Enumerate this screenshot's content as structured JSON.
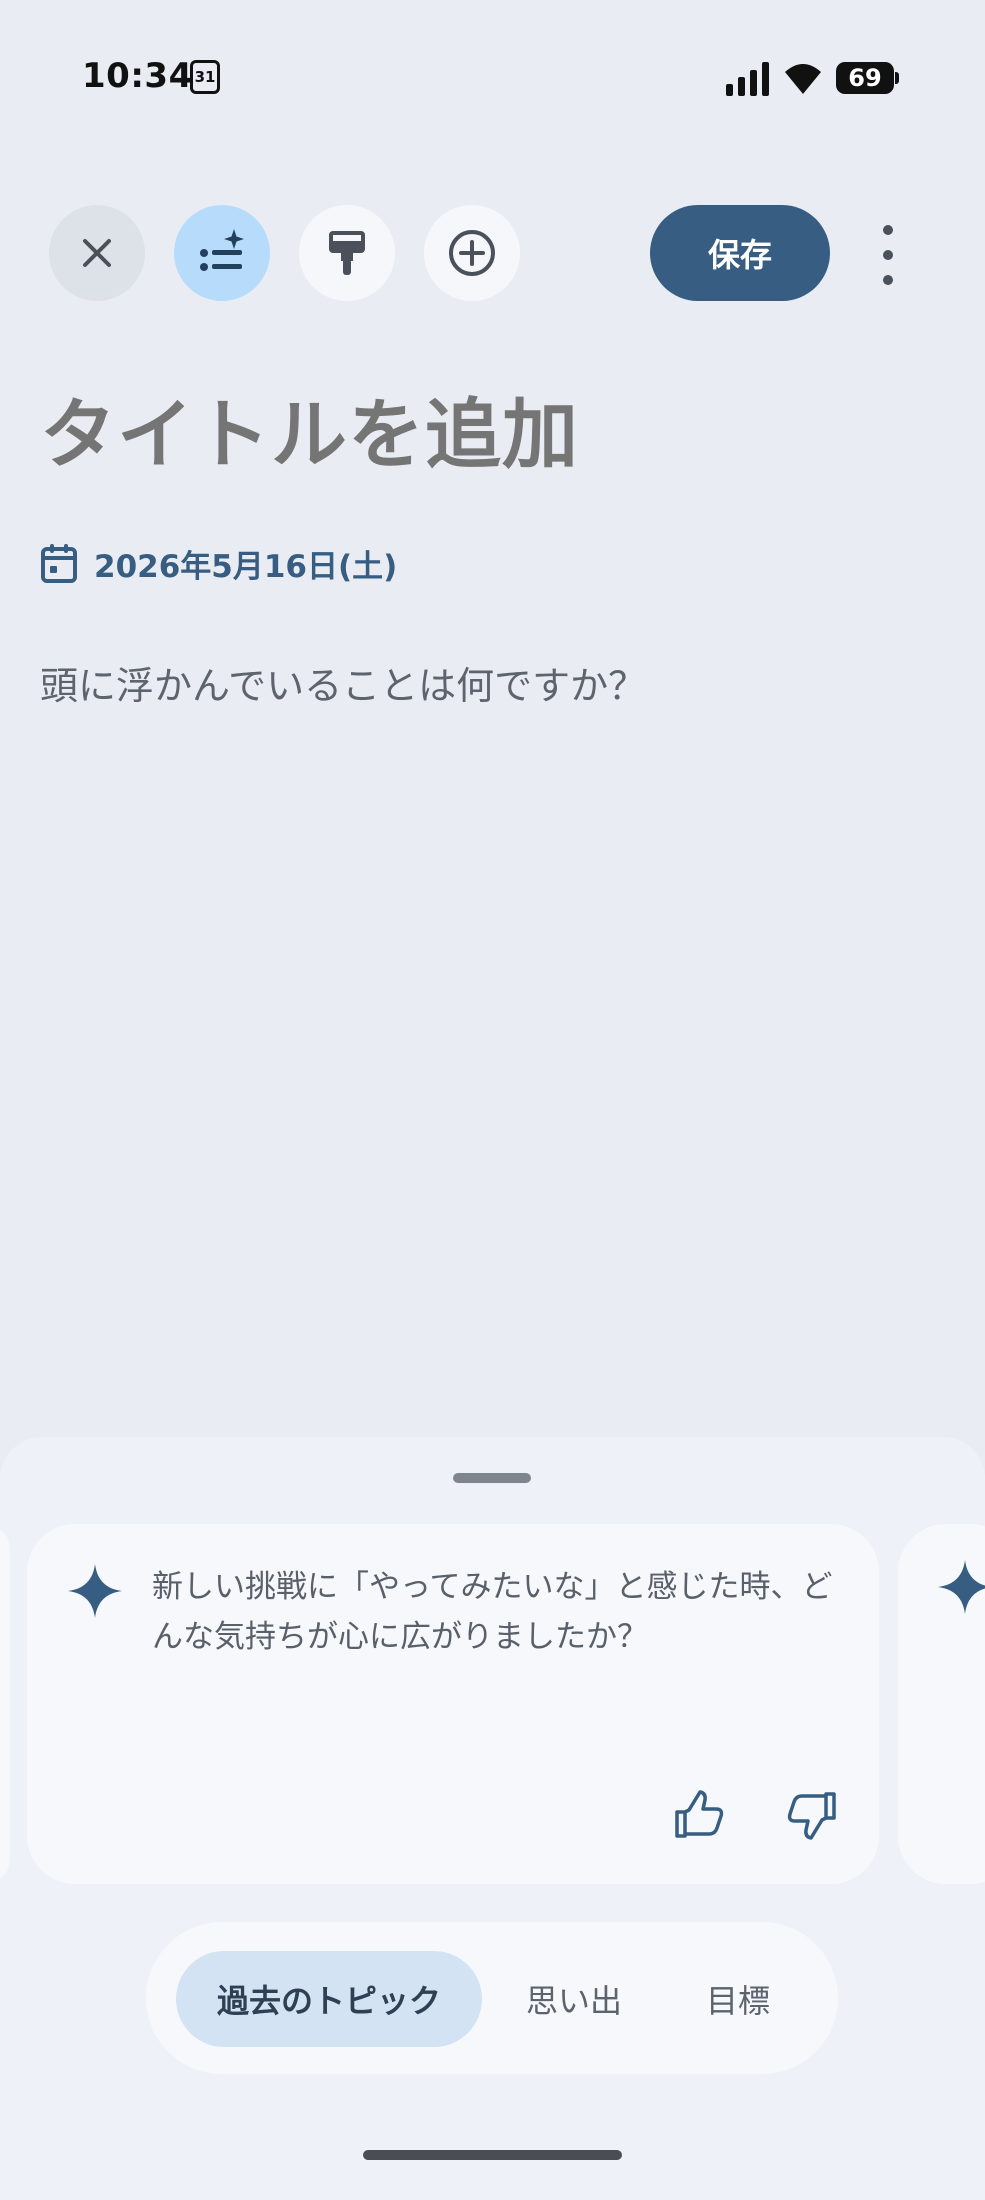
{
  "status_bar": {
    "time": "10:34",
    "calendar_day": "31",
    "battery": "69"
  },
  "toolbar": {
    "save_label": "保存",
    "icons": [
      "close-icon",
      "ai-list-icon",
      "paint-roller-icon",
      "add-circle-icon",
      "more-vert-icon"
    ]
  },
  "entry": {
    "title_placeholder": "タイトルを追加",
    "date": "2026年5月16日(土)",
    "body_prompt": "頭に浮かんでいることは何ですか？"
  },
  "suggestion_card": {
    "text": "新しい挑戦に「やってみたいな」と感じた時、どんな気持ちが心に広がりましたか？"
  },
  "tabs": {
    "items": [
      {
        "label": "過去のトピック",
        "selected": true
      },
      {
        "label": "思い出",
        "selected": false
      },
      {
        "label": "目標",
        "selected": false
      }
    ]
  },
  "colors": {
    "background": "#e9edf3",
    "accent": "#375e82",
    "chip_selected": "#b7dcfb",
    "tab_selected": "#d3e3f3"
  }
}
